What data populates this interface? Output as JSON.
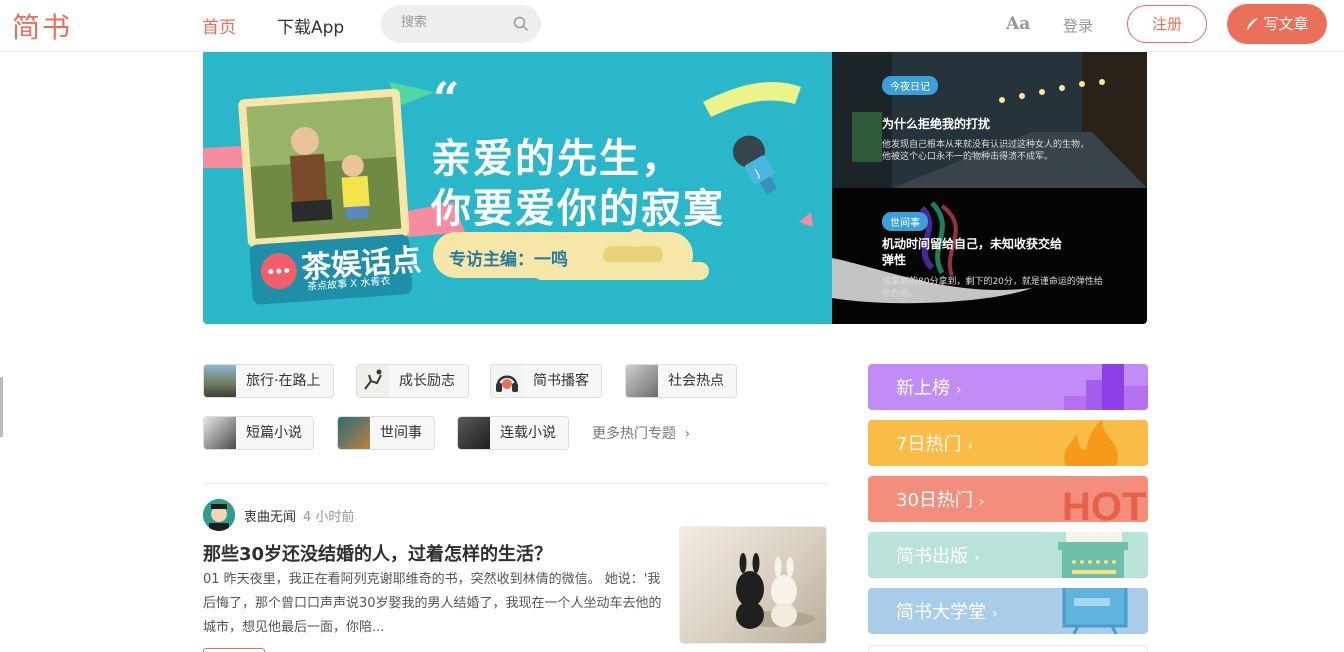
{
  "nav": {
    "logo": "简书",
    "home": "首页",
    "app": "下载App",
    "search_placeholder": "搜索",
    "font_toggle": "Aa",
    "login": "登录",
    "register": "注册",
    "write": "写文章"
  },
  "banner": {
    "quote_mark": "“",
    "line1": "亲爱的先生，",
    "line2": "你要爱你的寂寞",
    "pill": "专访主编：一鸣",
    "brand": "茶娱话点",
    "brand_sub": "茶点故事 X 水青衣"
  },
  "side_cards": [
    {
      "tag": "今夜日记",
      "title": "为什么拒绝我的打扰",
      "desc_line1": "他发现自己根本从来就没有认识过这种女人的生物，",
      "desc_line2": "他被这个心口永不一的物种击得溃不成军。"
    },
    {
      "tag": "世间事",
      "title_line1": "机动时间留给自己，未知收获交给",
      "title_line2": "弹性",
      "desc_line1": "该拿到的80分拿到，剩下的20分，就是谨命运的弹性给",
      "desc_line2": "你办完。"
    }
  ],
  "topics": [
    {
      "label": "旅行·在路上"
    },
    {
      "label": "成长励志"
    },
    {
      "label": "简书播客"
    },
    {
      "label": "社会热点"
    },
    {
      "label": "短篇小说"
    },
    {
      "label": "世间事"
    },
    {
      "label": "连载小说"
    }
  ],
  "more_topics": "更多热门专题",
  "article": {
    "author": "衷曲无闻",
    "time": "4 小时前",
    "title": "那些30岁还没结婚的人，过着怎样的生活？",
    "abstract_line1": "01 昨天夜里，我正在看阿列克谢耶维奇的书，突然收到林倩的微信。 她说：'我",
    "abstract_line2": "后悔了，那个曾口口声声说30岁娶我的男人结婚了，我现在一个人坐动车去他的",
    "abstract_line3": "城市，想见他最后一面，你陪..."
  },
  "boards": [
    {
      "label": "新上榜",
      "color": "#c18cf5"
    },
    {
      "label": "7日热门",
      "color": "#fbbb47"
    },
    {
      "label": "30日热门",
      "color": "#f38e7c"
    },
    {
      "label": "简书出版",
      "color": "#b9e3d9"
    },
    {
      "label": "简书大学堂",
      "color": "#a9cde8"
    }
  ],
  "colors": {
    "accent": "#ea6f5a",
    "banner_bg": "#2ab7c9"
  }
}
